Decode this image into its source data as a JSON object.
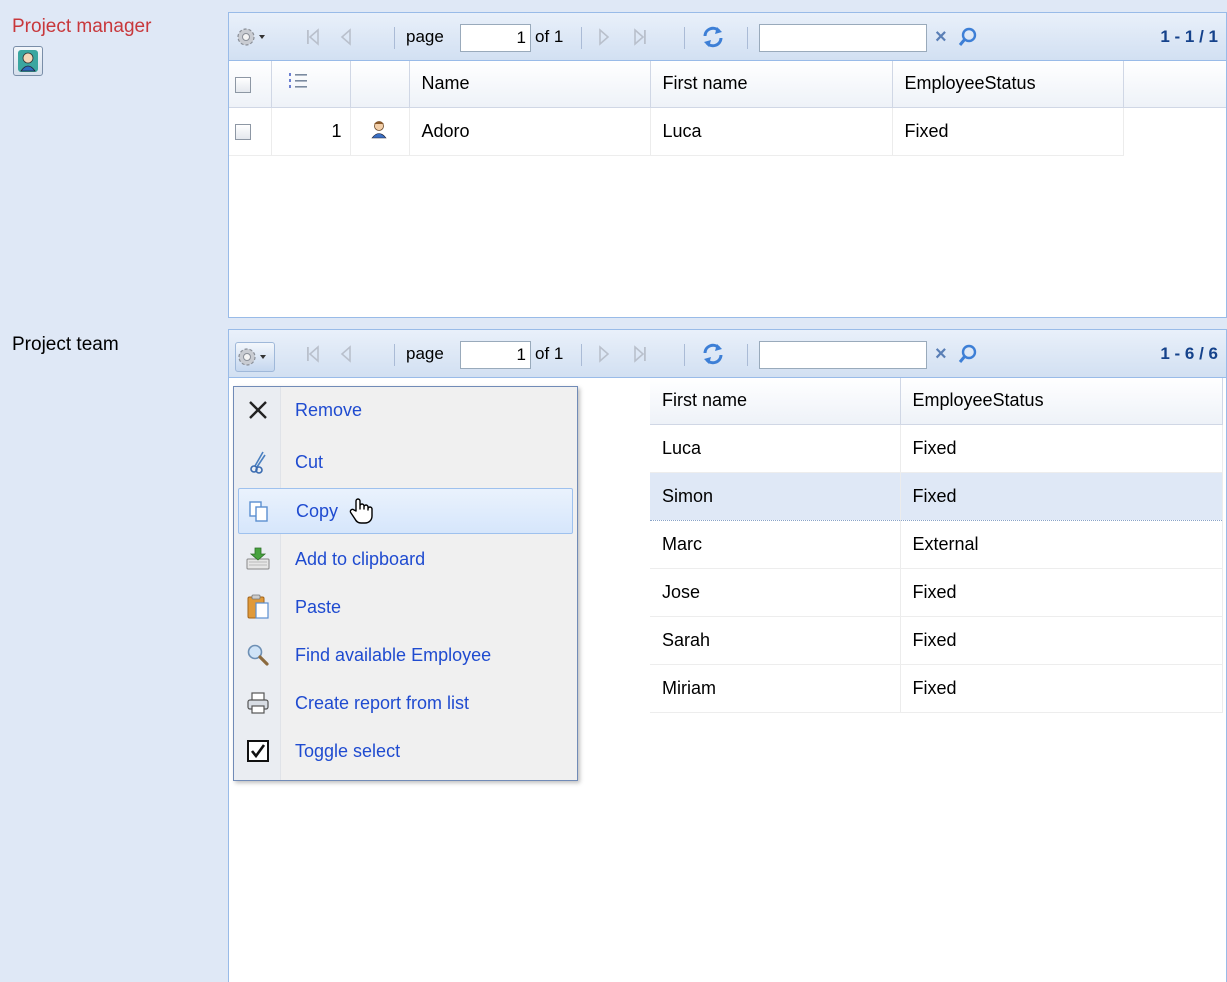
{
  "project_manager": {
    "label": "Project manager",
    "toolbar": {
      "page_label": "page",
      "page_value": "1",
      "of_label": "of 1",
      "search_value": "",
      "clear_symbol": "×",
      "range": "1 - 1 / 1"
    },
    "columns": [
      "Name",
      "First name",
      "EmployeeStatus"
    ],
    "rows": [
      {
        "num": "1",
        "name": "Adoro",
        "first_name": "Luca",
        "status": "Fixed"
      }
    ]
  },
  "project_team": {
    "label": "Project team",
    "toolbar": {
      "page_label": "page",
      "page_value": "1",
      "of_label": "of 1",
      "search_value": "",
      "clear_symbol": "×",
      "range": "1 - 6 / 6"
    },
    "columns": [
      "First name",
      "EmployeeStatus"
    ],
    "rows": [
      {
        "first_name": "Luca",
        "status": "Fixed"
      },
      {
        "first_name": "Simon",
        "status": "Fixed"
      },
      {
        "first_name": "Marc",
        "status": "External"
      },
      {
        "first_name": "Jose",
        "status": "Fixed"
      },
      {
        "first_name": "Sarah",
        "status": "Fixed"
      },
      {
        "first_name": "Miriam",
        "status": "Fixed"
      }
    ]
  },
  "context_menu": {
    "items": [
      {
        "label": "Remove",
        "icon": "close-icon"
      },
      {
        "label": "Cut",
        "icon": "scissors-icon"
      },
      {
        "label": "Copy",
        "icon": "copy-icon"
      },
      {
        "label": "Add to clipboard",
        "icon": "clipboard-add-icon"
      },
      {
        "label": "Paste",
        "icon": "paste-icon"
      },
      {
        "label": "Find available Employee",
        "icon": "magnifier-icon"
      },
      {
        "label": "Create report from list",
        "icon": "printer-icon"
      },
      {
        "label": "Toggle select",
        "icon": "checkbox-checked-icon"
      }
    ]
  },
  "colors": {
    "page_background": "#dfe8f6",
    "manager_label": "#c8373b",
    "menu_link": "#1f4bd0",
    "grid_border": "#99bbe8"
  }
}
